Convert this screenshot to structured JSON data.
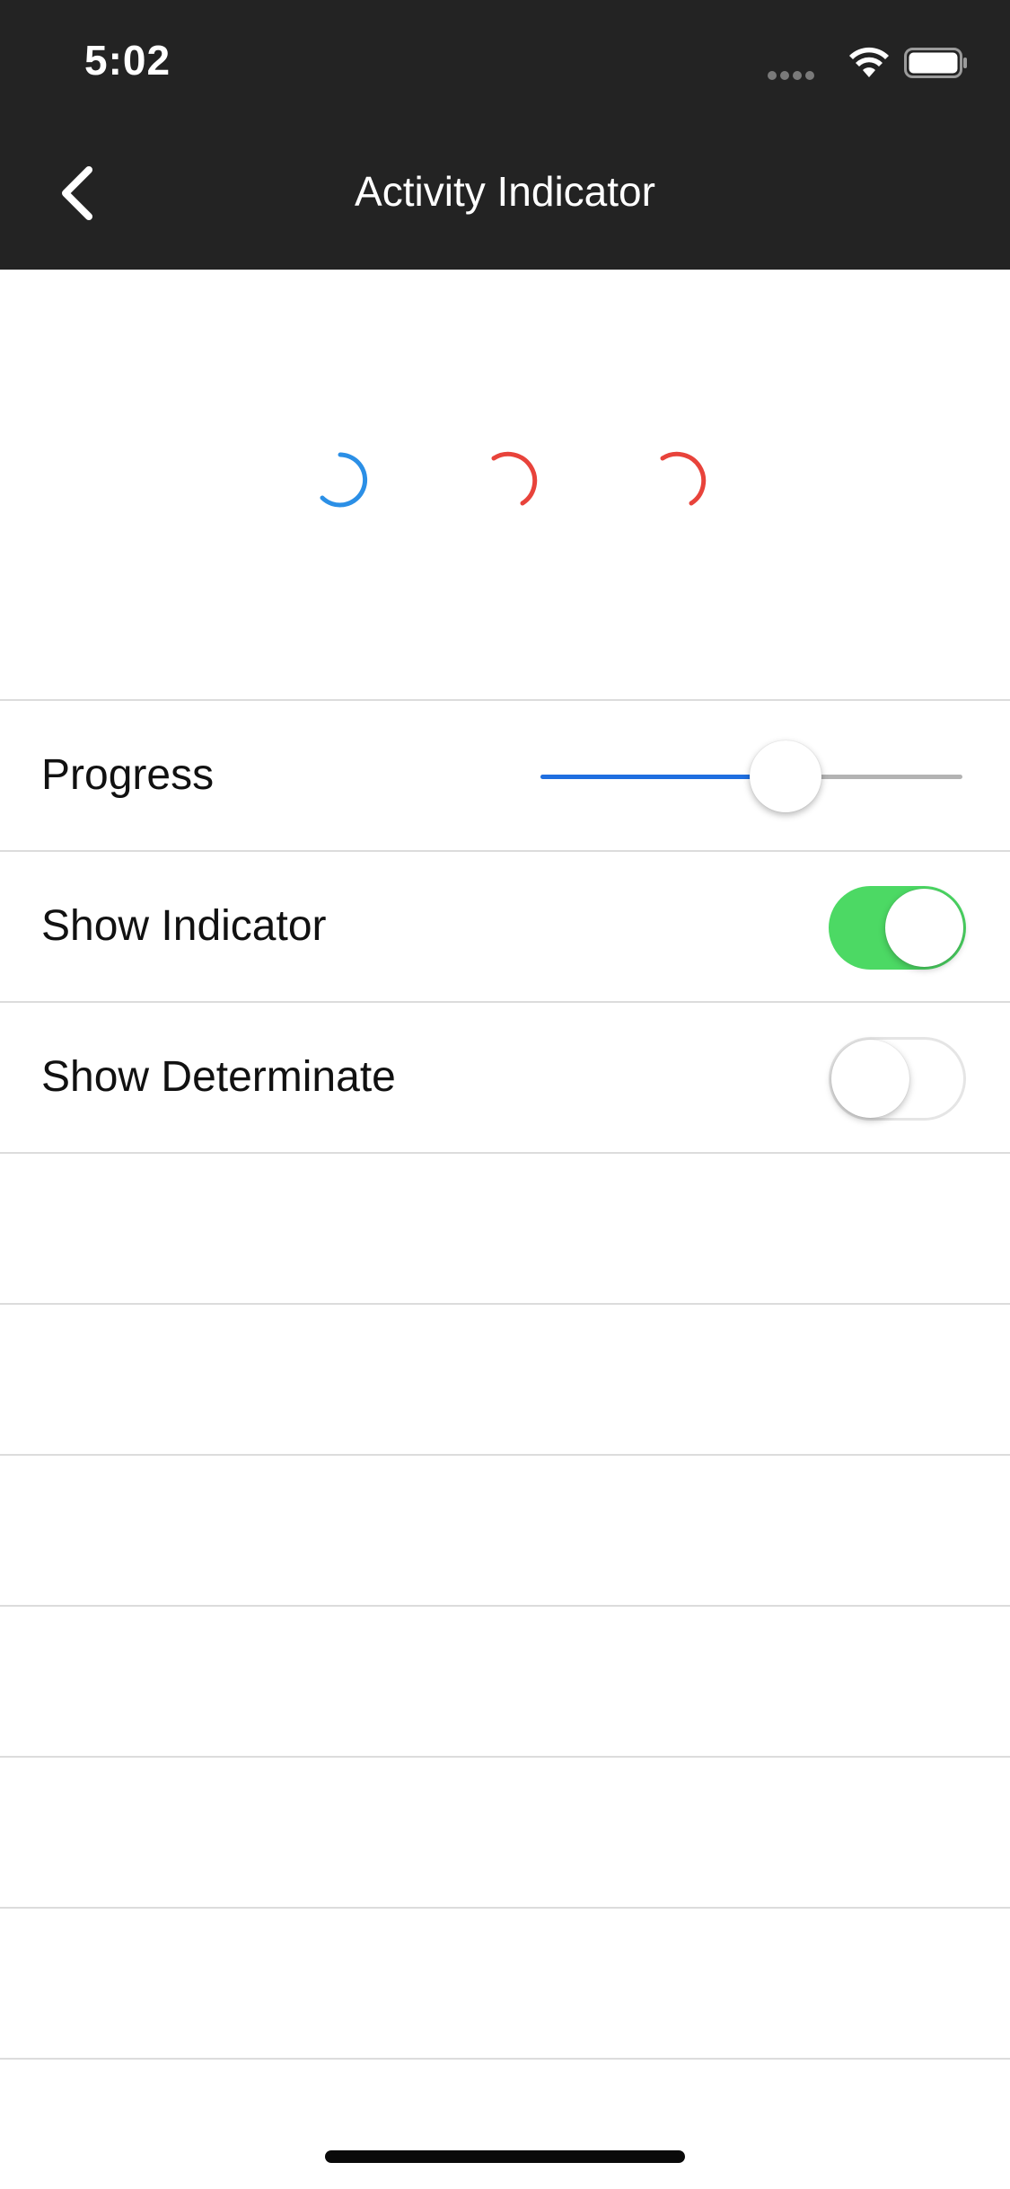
{
  "status_bar": {
    "time": "5:02",
    "icons": [
      "signal-dots-icon",
      "wifi-icon",
      "battery-icon"
    ]
  },
  "nav_bar": {
    "back_icon": "chevron-left-icon",
    "title": "Activity Indicator"
  },
  "indicators": [
    {
      "name": "spinner-blue",
      "color": "#2b8fe6"
    },
    {
      "name": "spinner-red-1",
      "color": "#e8433b"
    },
    {
      "name": "spinner-red-2",
      "color": "#e8433b"
    }
  ],
  "settings": {
    "progress": {
      "label": "Progress",
      "value": 0.58
    },
    "show_indicator": {
      "label": "Show Indicator",
      "on": true
    },
    "show_determinate": {
      "label": "Show Determinate",
      "on": false
    }
  },
  "colors": {
    "header_bg": "#232323",
    "slider_fill": "#1f6fe0",
    "toggle_on": "#4cd964"
  }
}
